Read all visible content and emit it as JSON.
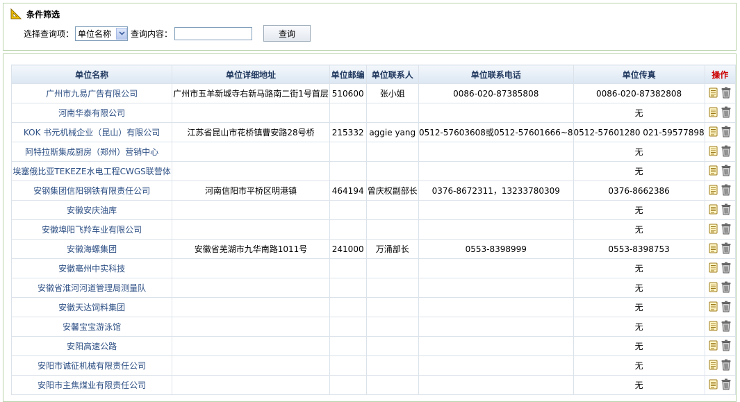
{
  "filter": {
    "title": "条件筛选",
    "select_label": "选择查询项：",
    "select_value": "单位名称",
    "content_label": "查询内容：",
    "content_value": "",
    "query_button": "查询"
  },
  "table": {
    "headers": [
      "单位名称",
      "单位详细地址",
      "单位邮编",
      "单位联系人",
      "单位联系电话",
      "单位传真",
      "操作"
    ],
    "rows": [
      [
        "广州市九易广告有限公司",
        "广州市五羊新城寺右新马路南二街1号首层",
        "510600",
        "张小姐",
        "0086-020-87385808",
        "0086-020-87382808"
      ],
      [
        "河南华泰有限公司",
        "",
        "",
        "",
        "",
        "无"
      ],
      [
        "KOK 书元机械企业（昆山）有限公司",
        "江苏省昆山市花桥镇曹安路28号桥",
        "215332",
        "aggie yang",
        "0512-57603608或0512-57601666~8",
        "0512-57601280 021-59577898"
      ],
      [
        "阿特拉斯集成厨房（郑州）营销中心",
        "",
        "",
        "",
        "",
        "无"
      ],
      [
        "埃塞俄比亚TEKEZE水电工程CWGS联营体",
        "",
        "",
        "",
        "",
        "无"
      ],
      [
        "安钢集团信阳钢铁有限责任公司",
        "河南信阳市平桥区明港镇",
        "464194",
        "曾庆权副部长",
        "0376-8672311，13233780309",
        "0376-8662386"
      ],
      [
        "安徽安庆油库",
        "",
        "",
        "",
        "",
        "无"
      ],
      [
        "安徽埠阳飞羚车业有限公司",
        "",
        "",
        "",
        "",
        "无"
      ],
      [
        "安徽海螺集团",
        "安徽省芜湖市九华南路1011号",
        "241000",
        "万涌部长",
        "0553-8398999",
        "0553-8398753"
      ],
      [
        "安徽亳州中实科技",
        "",
        "",
        "",
        "",
        "无"
      ],
      [
        "安徽省淮河河道管理局测量队",
        "",
        "",
        "",
        "",
        "无"
      ],
      [
        "安徽天达饲料集团",
        "",
        "",
        "",
        "",
        "无"
      ],
      [
        "安馨宝宝游泳馆",
        "",
        "",
        "",
        "",
        "无"
      ],
      [
        "安阳高速公路",
        "",
        "",
        "",
        "",
        "无"
      ],
      [
        "安阳市诚征机械有限责任公司",
        "",
        "",
        "",
        "",
        "无"
      ],
      [
        "安阳市主焦煤业有限责任公司",
        "",
        "",
        "",
        "",
        "无"
      ]
    ]
  },
  "icons": {
    "edit": "document-edit-icon",
    "delete": "trash-icon"
  }
}
